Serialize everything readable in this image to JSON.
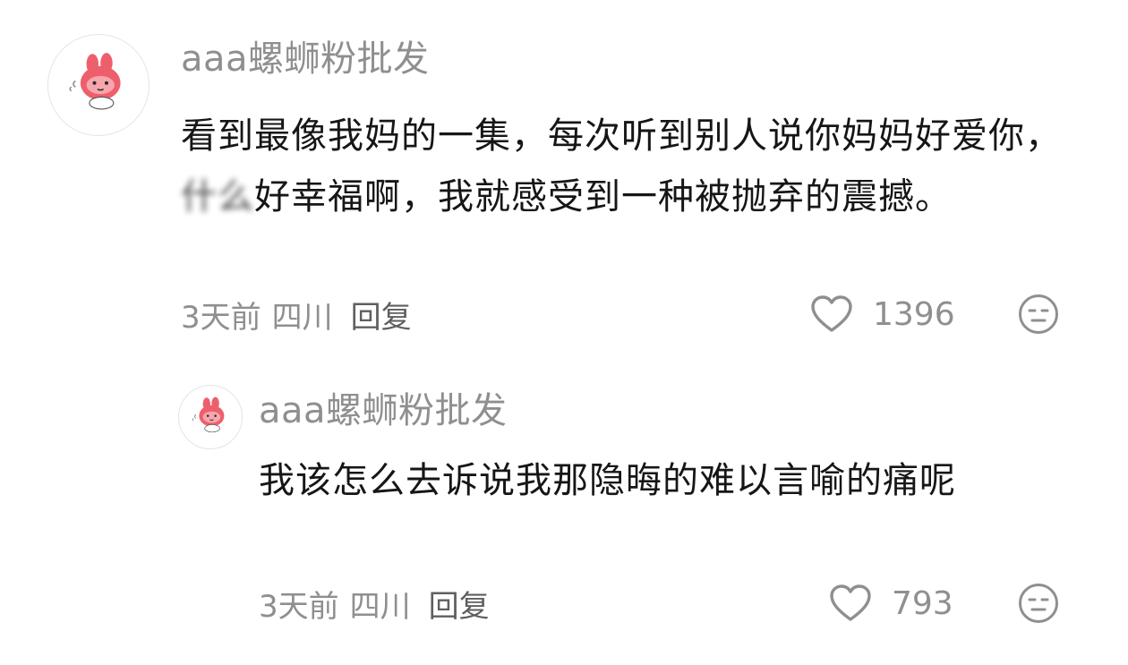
{
  "comments": [
    {
      "username": "aaa螺蛳粉批发",
      "text_before": "看到最像我妈的一集，每次听到别人说你妈妈好爱你，",
      "text_blurred": "什么",
      "text_after": "好幸福啊，我就感受到一种被抛弃的震撼。",
      "time": "3天前",
      "location": "四川",
      "reply_label": "回复",
      "likes": "1396"
    },
    {
      "username": "aaa螺蛳粉批发",
      "text": "我该怎么去诉说我那隐晦的难以言喻的痛呢",
      "time": "3天前",
      "location": "四川",
      "reply_label": "回复",
      "likes": "793"
    }
  ],
  "icons": {
    "like": "heart-outline-icon",
    "dislike": "meh-face-icon",
    "avatar": "pink-bunny-sticker"
  },
  "colors": {
    "username": "#8f8f8f",
    "text": "#161616",
    "meta": "#8f8f8f",
    "avatar_pink": "#ee5f6c"
  }
}
